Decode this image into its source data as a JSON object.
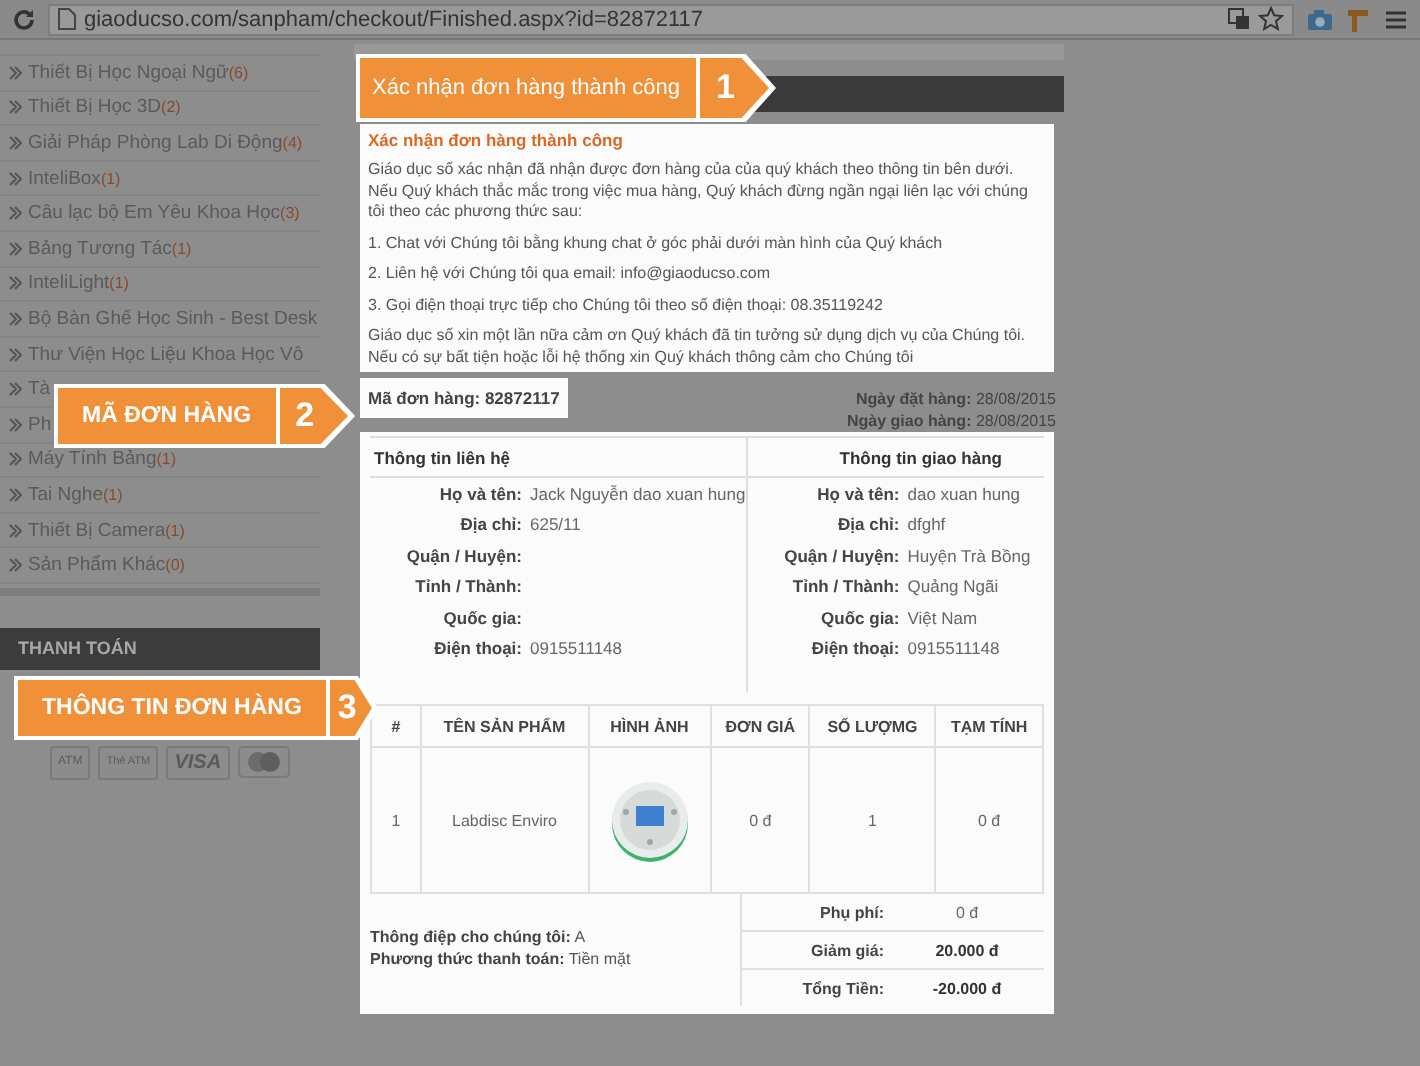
{
  "browser": {
    "url": "giaoducso.com/sanpham/checkout/Finished.aspx?id=82872117"
  },
  "sidebar": {
    "categories": [
      {
        "name": "Thiết Bị Học Ngoại Ngữ",
        "count": "(6)"
      },
      {
        "name": "Thiết Bị Học 3D",
        "count": "(2)"
      },
      {
        "name": "Giải Pháp Phòng Lab Di Động",
        "count": "(4)"
      },
      {
        "name": "InteliBox",
        "count": "(1)"
      },
      {
        "name": "Câu lạc bộ Em Yêu Khoa Học",
        "count": "(3)"
      },
      {
        "name": "Bảng Tương Tác",
        "count": "(1)"
      },
      {
        "name": "InteliLight",
        "count": "(1)"
      },
      {
        "name": "Bộ Bàn Ghế Học Sinh - Best Desk"
      },
      {
        "name": "Thư Viện Học Liệu Khoa Học Vô"
      },
      {
        "name": "Tà"
      },
      {
        "name": "Ph"
      },
      {
        "name": "Máy Tính Bảng",
        "count": "(1)"
      },
      {
        "name": "Tai Nghe",
        "count": "(1)"
      },
      {
        "name": "Thiết Bị Camera",
        "count": "(1)"
      },
      {
        "name": "Sản Phẩm Khác",
        "count": "(0)"
      }
    ],
    "payment_title": "THANH TOÁN",
    "payment_methods": [
      {
        "kind": "atm",
        "text": "ATM"
      },
      {
        "kind": "card",
        "text": "Thẻ ATM"
      },
      {
        "kind": "visa",
        "text": "VISA"
      },
      {
        "kind": "mastercard"
      }
    ]
  },
  "callouts": [
    {
      "number": "1",
      "label": "Xác nhận đơn hàng thành công"
    },
    {
      "number": "2",
      "label": "MÃ ĐƠN HÀNG"
    },
    {
      "number": "3",
      "label": "THÔNG TIN ĐƠN HÀNG"
    }
  ],
  "confirmation": {
    "title": "Xác nhận đơn hàng thành công",
    "paragraphs": [
      "Giáo dục số xác nhận đã nhận được đơn hàng của của quý khách theo thông tin bên dưới. Nếu Quý khách thắc mắc trong việc mua hàng, Quý khách đừng ngần ngại liên lạc với chúng tôi theo các phương thức sau:",
      "1. Chat với Chúng tôi bằng khung chat ở góc phải dưới màn hình của Quý khách",
      "2. Liên hệ với Chúng tôi qua email: info@giaoducso.com",
      "3. Gọi điện thoại trực tiếp cho Chúng tôi theo số điện thoại: 08.35119242",
      "Giáo dục số xin một lần nữa cảm ơn Quý khách đã tin tưởng sử dụng dịch vụ của Chúng tôi. Nếu có sự bất tiện hoặc lỗi hệ thống xin Quý khách thông cảm cho Chúng tôi"
    ]
  },
  "order_code": {
    "label": "Mã đơn hàng:",
    "value": "82872117"
  },
  "dates": [
    {
      "label": "Ngày đặt hàng:",
      "value": "28/08/2015"
    },
    {
      "label": "Ngày giao hàng:",
      "value": "28/08/2015"
    }
  ],
  "info": [
    {
      "title": "Thông tin liên hệ",
      "fields": [
        {
          "label": "Họ và tên:",
          "value": "Jack Nguyễn dao xuan hung"
        },
        {
          "label": "Địa chỉ:",
          "value": "625/11"
        },
        {
          "label": "Quận / Huyện:"
        },
        {
          "label": "Tỉnh / Thành:"
        },
        {
          "label": "Quốc gia:"
        },
        {
          "label": "Điện thoại:",
          "value": "0915511148"
        }
      ]
    },
    {
      "title": "Thông tin giao hàng",
      "fields": [
        {
          "label": "Họ và tên:",
          "value": "dao xuan hung"
        },
        {
          "label": "Địa chỉ:",
          "value": "dfghf"
        },
        {
          "label": "Quận / Huyện:",
          "value": "Huyện Trà Bồng"
        },
        {
          "label": "Tỉnh / Thành:",
          "value": "Quảng Ngãi"
        },
        {
          "label": "Quốc gia:",
          "value": "Việt Nam"
        },
        {
          "label": "Điện thoại:",
          "value": "0915511148"
        }
      ]
    }
  ],
  "table": {
    "columns": [
      "#",
      "TÊN SẢN PHẨM",
      "HÌNH ẢNH",
      "ĐƠN GIÁ",
      "SỐ LƯỢMG",
      "TẠM TÍNH"
    ],
    "rows": [
      {
        "cells": [
          {
            "kind": "text",
            "text": "1"
          },
          {
            "kind": "text",
            "text": "Labdisc Enviro"
          },
          {
            "kind": "picture"
          },
          {
            "kind": "text",
            "text": "0 đ"
          },
          {
            "kind": "text",
            "text": "1"
          },
          {
            "kind": "text",
            "text": "0 đ"
          }
        ]
      }
    ]
  },
  "notes": [
    {
      "label": "Thông điệp cho chúng tôi:",
      "value": "A"
    },
    {
      "label": "Phương thức thanh toán:",
      "value": "Tiền mặt"
    }
  ],
  "totals": [
    {
      "label": "Phụ phí:",
      "value": "0 đ",
      "emphasis": false
    },
    {
      "label": "Giảm giá:",
      "value": "20.000 đ",
      "emphasis": true
    },
    {
      "label": "Tổng Tiền:",
      "value": "-20.000 đ",
      "emphasis": true
    }
  ]
}
